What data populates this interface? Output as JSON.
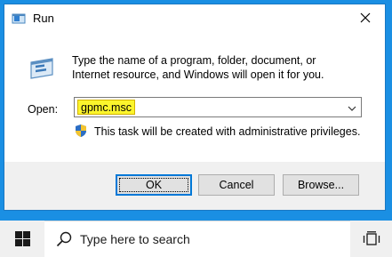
{
  "dialog": {
    "title": "Run",
    "description": "Type the name of a program, folder, document, or Internet resource, and Windows will open it for you.",
    "open_label": "Open:",
    "open_value": "gpmc.msc",
    "admin_note": "This task will be created with administrative privileges.",
    "buttons": {
      "ok": "OK",
      "cancel": "Cancel",
      "browse": "Browse..."
    }
  },
  "taskbar": {
    "search_placeholder": "Type here to search"
  },
  "colors": {
    "desktop": "#1a8fe3",
    "highlight": "#fbf52c",
    "focus_border": "#0078d7"
  },
  "icons": [
    "run-app-icon",
    "close-icon",
    "run-program-icon",
    "dropdown-chevron-icon",
    "uac-shield-icon",
    "windows-logo-icon",
    "search-icon",
    "task-view-icon"
  ]
}
